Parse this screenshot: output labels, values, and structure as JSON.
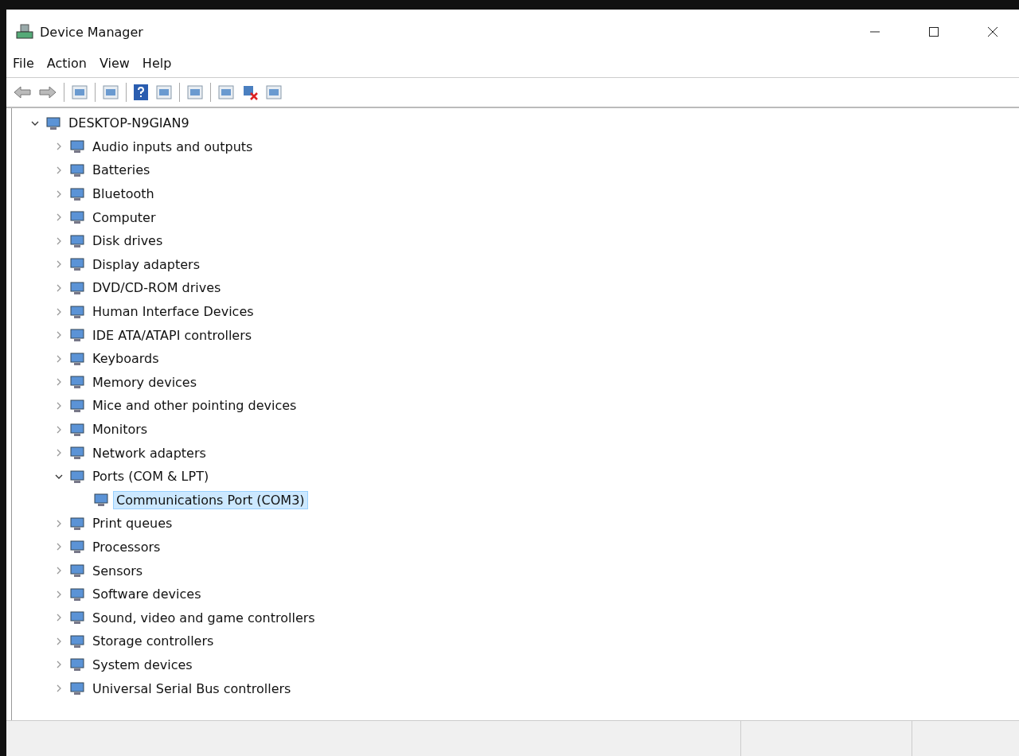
{
  "window": {
    "title": "Device Manager"
  },
  "menu": [
    "File",
    "Action",
    "View",
    "Help"
  ],
  "tree": {
    "label": "DESKTOP-N9GIAN9",
    "expanded": true,
    "selected": false,
    "children": [
      {
        "label": "Audio inputs and outputs",
        "expanded": false,
        "selected": false
      },
      {
        "label": "Batteries",
        "expanded": false,
        "selected": false
      },
      {
        "label": "Bluetooth",
        "expanded": false,
        "selected": false
      },
      {
        "label": "Computer",
        "expanded": false,
        "selected": false
      },
      {
        "label": "Disk drives",
        "expanded": false,
        "selected": false
      },
      {
        "label": "Display adapters",
        "expanded": false,
        "selected": false
      },
      {
        "label": "DVD/CD-ROM drives",
        "expanded": false,
        "selected": false
      },
      {
        "label": "Human Interface Devices",
        "expanded": false,
        "selected": false
      },
      {
        "label": "IDE ATA/ATAPI controllers",
        "expanded": false,
        "selected": false
      },
      {
        "label": "Keyboards",
        "expanded": false,
        "selected": false
      },
      {
        "label": "Memory devices",
        "expanded": false,
        "selected": false
      },
      {
        "label": "Mice and other pointing devices",
        "expanded": false,
        "selected": false
      },
      {
        "label": "Monitors",
        "expanded": false,
        "selected": false
      },
      {
        "label": "Network adapters",
        "expanded": false,
        "selected": false
      },
      {
        "label": "Ports (COM & LPT)",
        "expanded": true,
        "selected": false,
        "children": [
          {
            "label": "Communications Port (COM3)",
            "selected": true
          }
        ]
      },
      {
        "label": "Print queues",
        "expanded": false,
        "selected": false
      },
      {
        "label": "Processors",
        "expanded": false,
        "selected": false
      },
      {
        "label": "Sensors",
        "expanded": false,
        "selected": false
      },
      {
        "label": "Software devices",
        "expanded": false,
        "selected": false
      },
      {
        "label": "Sound, video and game controllers",
        "expanded": false,
        "selected": false
      },
      {
        "label": "Storage controllers",
        "expanded": false,
        "selected": false
      },
      {
        "label": "System devices",
        "expanded": false,
        "selected": false
      },
      {
        "label": "Universal Serial Bus controllers",
        "expanded": false,
        "selected": false
      }
    ]
  }
}
